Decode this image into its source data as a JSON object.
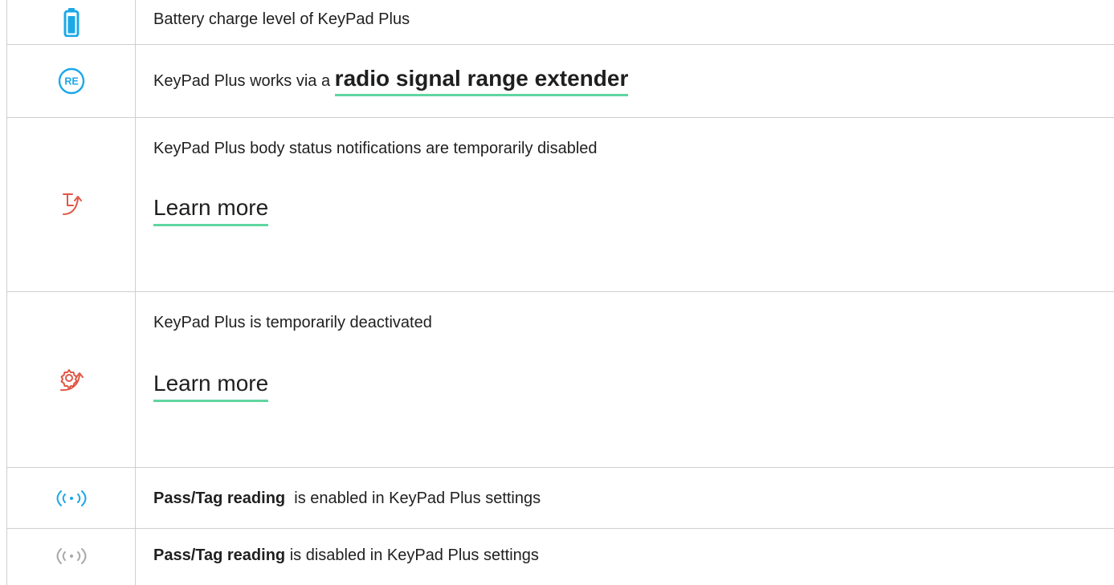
{
  "colors": {
    "accent_blue": "#1ca8e8",
    "accent_red": "#e05745",
    "grey_icon": "#a8a8a8",
    "link_underline": "#5fd6a0",
    "border": "#cfcfcf"
  },
  "rows": [
    {
      "icon": "battery-icon",
      "text": "Battery charge level of KeyPad Plus"
    },
    {
      "icon": "range-extender-icon",
      "icon_text": "RE",
      "text_prefix": "KeyPad Plus works via a",
      "link": "radio signal range extender"
    },
    {
      "icon": "body-notifications-disabled-icon",
      "text": "KeyPad Plus body status notifications are temporarily disabled",
      "link": "Learn more"
    },
    {
      "icon": "temporarily-deactivated-icon",
      "text": "KeyPad Plus is temporarily deactivated",
      "link": "Learn more"
    },
    {
      "icon": "pass-tag-enabled-icon",
      "bold": "Pass/Tag reading",
      "text": " is enabled in KeyPad Plus settings"
    },
    {
      "icon": "pass-tag-disabled-icon",
      "bold": "Pass/Tag reading",
      "text": "is disabled in KeyPad Plus settings"
    }
  ]
}
